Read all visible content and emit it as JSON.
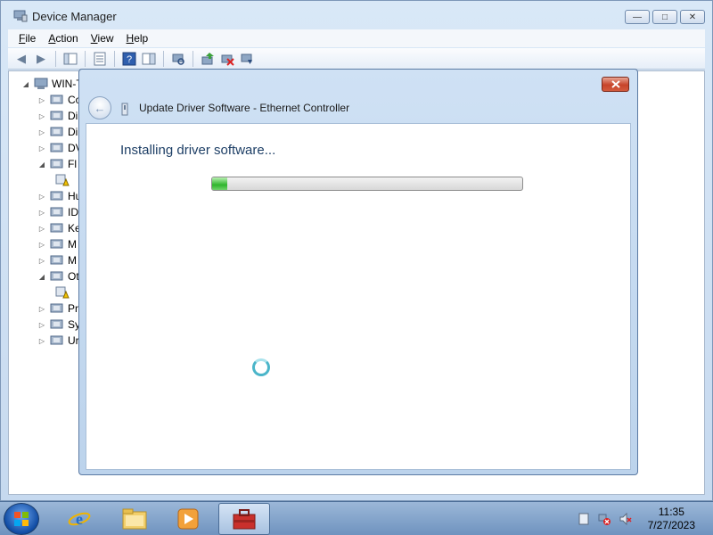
{
  "device_manager": {
    "title": "Device Manager",
    "menu": [
      {
        "key": "F",
        "rest": "ile"
      },
      {
        "key": "A",
        "rest": "ction"
      },
      {
        "key": "V",
        "rest": "iew"
      },
      {
        "key": "H",
        "rest": "elp"
      }
    ],
    "tree": {
      "root_label": "WIN-T",
      "nodes": [
        "Co",
        "Di",
        "Di",
        "DV",
        "Fl",
        "",
        "Hu",
        "ID",
        "Ke",
        "M",
        "M",
        "Ot",
        "",
        "Pr",
        "Sy",
        "Ur"
      ]
    },
    "window_buttons": {
      "minimize": "—",
      "maximize": "□",
      "close": "✕"
    }
  },
  "dialog": {
    "title": "Update Driver Software - Ethernet Controller",
    "heading": "Installing driver software...",
    "progress_fraction": 0.05,
    "close_label": "x"
  },
  "taskbar": {
    "time": "11:35",
    "date": "7/27/2023"
  },
  "colors": {
    "dialog_heading": "#1e3f66",
    "progress_green": "#2fb52d",
    "spinner": "#4ab5c9"
  }
}
